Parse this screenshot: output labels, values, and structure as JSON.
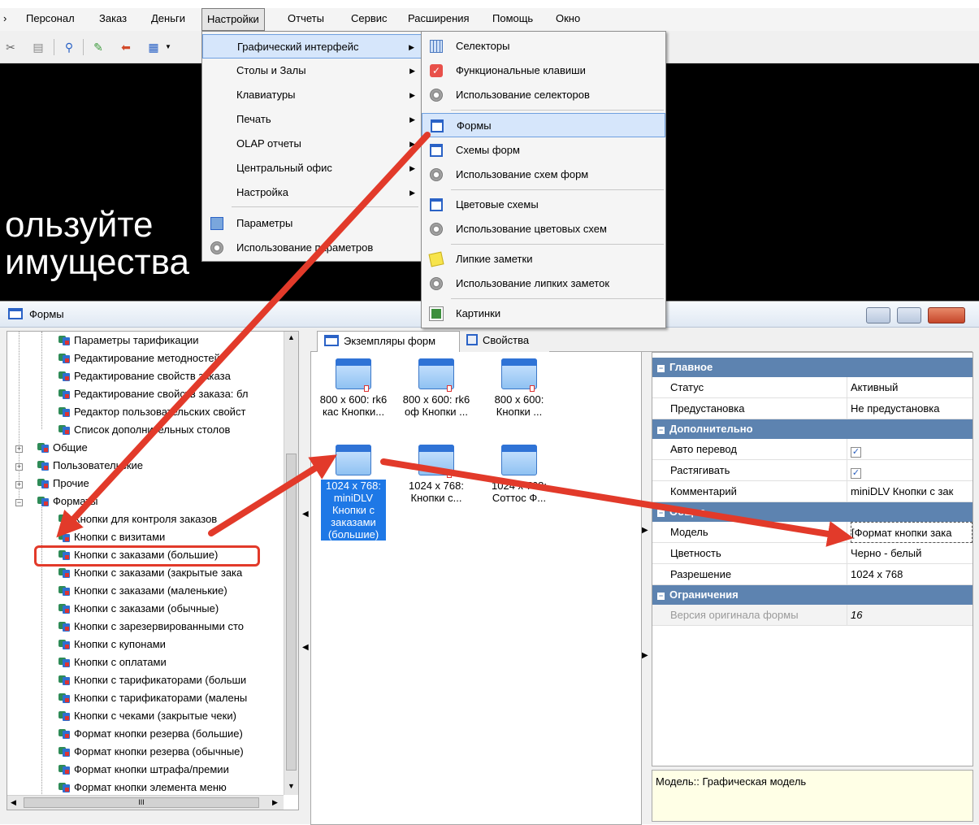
{
  "menubar": {
    "items": [
      "Персонал",
      "Заказ",
      "Деньги",
      "Настройки",
      "Отчеты",
      "Сервис",
      "Расширения",
      "Помощь",
      "Окно"
    ],
    "left_fragment": "›"
  },
  "background_text": {
    "line1": "ользуйте",
    "line2": "имущества"
  },
  "settings_menu": {
    "items": [
      {
        "label": "Графический интерфейс",
        "submenu": true
      },
      {
        "label": "Столы и Залы",
        "submenu": true
      },
      {
        "label": "Клавиатуры",
        "submenu": true
      },
      {
        "label": "Печать",
        "submenu": true
      },
      {
        "label": "OLAP отчеты",
        "submenu": true
      },
      {
        "label": "Центральный офис",
        "submenu": true
      },
      {
        "label": "Настройка",
        "submenu": true
      },
      {
        "label": "Параметры",
        "submenu": false
      },
      {
        "label": "Использование параметров",
        "submenu": false
      }
    ],
    "arrow_glyph": "▶"
  },
  "gui_submenu": {
    "items": [
      {
        "label": "Селекторы",
        "icon": "grid-icon"
      },
      {
        "label": "Функциональные клавиши",
        "icon": "check-icon"
      },
      {
        "label": "Использование селекторов",
        "icon": "gear-icon"
      },
      {
        "label": "Формы",
        "icon": "window-icon"
      },
      {
        "label": "Схемы форм",
        "icon": "window-icon"
      },
      {
        "label": "Использование схем форм",
        "icon": "gear-icon"
      },
      {
        "label": "Цветовые схемы",
        "icon": "window-icon"
      },
      {
        "label": "Использование цветовых схем",
        "icon": "gear-icon"
      },
      {
        "label": "Липкие заметки",
        "icon": "note-icon"
      },
      {
        "label": "Использование липких заметок",
        "icon": "gear-icon"
      },
      {
        "label": "Картинки",
        "icon": "picture-icon"
      }
    ]
  },
  "window": {
    "title": "Формы"
  },
  "tree": {
    "items": [
      {
        "label": "Параметры тарификации"
      },
      {
        "label": "Редактирование методностей"
      },
      {
        "label": "Редактирование свойств заказа"
      },
      {
        "label": "Редактирование свойств заказа: бл"
      },
      {
        "label": "Редактор пользовательских свойст"
      },
      {
        "label": "Список дополнительных столов"
      },
      {
        "label": "Общие"
      },
      {
        "label": "Пользовательские"
      },
      {
        "label": "Прочие"
      },
      {
        "label": "Форматы"
      },
      {
        "label": "Кнопки для контроля заказов"
      },
      {
        "label": "Кнопки с визитами"
      },
      {
        "label": "Кнопки с заказами (большие)"
      },
      {
        "label": "Кнопки с заказами (закрытые зака"
      },
      {
        "label": "Кнопки с заказами (маленькие)"
      },
      {
        "label": "Кнопки с заказами (обычные)"
      },
      {
        "label": "Кнопки с зарезервированными сто"
      },
      {
        "label": "Кнопки с купонами"
      },
      {
        "label": "Кнопки с оплатами"
      },
      {
        "label": "Кнопки с тарификаторами (больши"
      },
      {
        "label": "Кнопки с тарификаторами (малены"
      },
      {
        "label": "Кнопки с чеками (закрытые чеки)"
      },
      {
        "label": "Формат кнопки резерва (большие)"
      },
      {
        "label": "Формат кнопки резерва (обычные)"
      },
      {
        "label": "Формат кнопки штрафа/премии"
      },
      {
        "label": "Формат кнопки элемента меню"
      }
    ],
    "hscroll_label": "III"
  },
  "tabs": [
    {
      "label": "Экземпляры форм",
      "selected": true
    },
    {
      "label": "Свойства",
      "selected": false
    }
  ],
  "instances": [
    {
      "line1": "800 x 600: rk6",
      "line2": "кас Кнопки..."
    },
    {
      "line1": "800 x 600: rk6",
      "line2": "оф Кнопки ..."
    },
    {
      "line1": "800 x 600:",
      "line2": "Кнопки ..."
    },
    {
      "line1": "1024 x 768:",
      "line2": "miniDLV Кнопки с заказами (большие)",
      "selected": true
    },
    {
      "line1": "1024 x 768:",
      "line2": "Кнопки с..."
    },
    {
      "line1": "1024 x 768:",
      "line2": "Соттос Ф..."
    }
  ],
  "properties": {
    "categories": {
      "main": "Главное",
      "extra": "Дополнительно",
      "general": "Общие",
      "limits": "Ограничения"
    },
    "rows": {
      "status": {
        "name": "Статус",
        "value": "Активный"
      },
      "preset": {
        "name": "Предустановка",
        "value": "Не предустановка"
      },
      "auto": {
        "name": "Авто перевод",
        "value": "✓"
      },
      "stretch": {
        "name": "Растягивать",
        "value": "✓"
      },
      "comment": {
        "name": "Комментарий",
        "value": "miniDLV Кнопки с зак"
      },
      "model": {
        "name": "Модель",
        "value": "[Формат кнопки зака"
      },
      "color": {
        "name": "Цветность",
        "value": "Черно - белый"
      },
      "resolution": {
        "name": "Разрешение",
        "value": "1024 x 768"
      },
      "version": {
        "name": "Версия оригинала формы",
        "value": "16"
      }
    }
  },
  "description": "Модель:: Графическая модель",
  "colors": {
    "arrow": "#e23a2a",
    "category_bg": "#5d83b0",
    "selection": "#1e78e6"
  }
}
